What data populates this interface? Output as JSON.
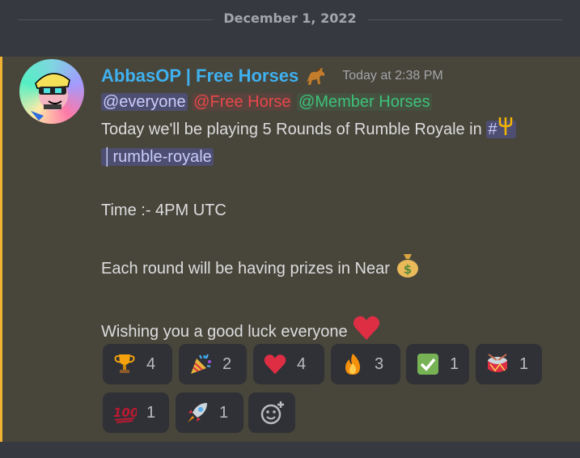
{
  "date_divider": "December 1, 2022",
  "message": {
    "username": "AbbasOP | Free Horses",
    "username_icon": "horse-emoji",
    "timestamp": "Today at 2:38 PM",
    "mentions": {
      "everyone": "@everyone",
      "role1": "@Free Horse",
      "role2": "@Member Horses"
    },
    "line1_text": "Today we'll be playing 5 Rounds of Rumble Royale in ",
    "channel_hash": "#",
    "channel_name": "│rumble-royale",
    "time_line": "Time :- 4PM UTC",
    "prizes_line": "Each round will be having prizes in Near ",
    "wish_line": "Wishing you a good luck everyone ",
    "highlight_color": "#f0b232",
    "username_color": "#3fb1ef"
  },
  "reactions": [
    {
      "emoji": "trophy",
      "count": "4"
    },
    {
      "emoji": "party-popper",
      "count": "2"
    },
    {
      "emoji": "heart",
      "count": "4"
    },
    {
      "emoji": "fire",
      "count": "3"
    },
    {
      "emoji": "check-mark",
      "count": "1"
    },
    {
      "emoji": "drum",
      "count": "1"
    },
    {
      "emoji": "hundred-points",
      "count": "1"
    },
    {
      "emoji": "rocket",
      "count": "1"
    }
  ],
  "add_reaction_icon": "add-reaction-icon"
}
